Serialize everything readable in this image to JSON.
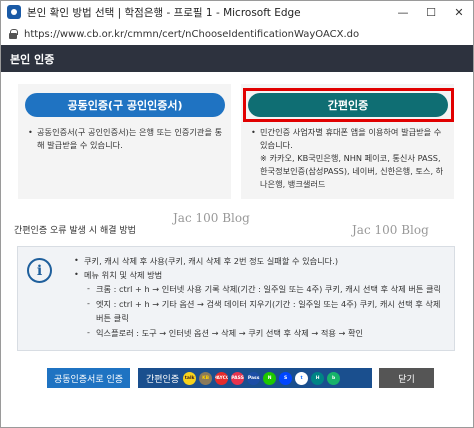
{
  "window": {
    "title": "본인 확인 방법 선택 | 학점은행 - 프로필 1 - Microsoft Edge",
    "controls": [
      "—",
      "☐",
      "✕"
    ]
  },
  "address": {
    "url": "https://www.cb.or.kr/cmmn/cert/nChooseIdentificationWayOACX.do"
  },
  "dialog": {
    "title": "본인 인증",
    "cards": {
      "public": {
        "label": "공동인증(구 공인인증서)",
        "text": "공동인증서(구 공인인증서)는 은행 또는 인증기관을 통해 발급받을 수 있습니다."
      },
      "simple": {
        "label": "간편인증",
        "text": "민간인증 사업자별 휴대폰 앱을 이용하여 발급받을 수 있습니다.",
        "note": "※ 카카오, KB국민은행, NHN 페이코, 통신사 PASS, 한국정보인증(삼성PASS), 네이버, 신한은행, 토스, 하나은행, 뱅크샐러드"
      }
    },
    "watermark": "Jac 100 Blog",
    "help": {
      "title": "간편인증 오류 발생 시 해결 방법",
      "lines": [
        "쿠키, 캐시 삭제 후 사용(쿠키, 캐시 삭제 후 2번 정도 실패할 수 있습니다.)",
        "메뉴 위치 및 삭제 방법",
        "크롬 : ctrl + h → 인터넷 사용 기록 삭제(기간 : 일주일 또는 4주) 쿠키, 캐시 선택 후 삭제 버튼 클릭",
        "엣지 : ctrl + h → 기타 옵션 → 검색 데이터 지우기(기간 : 일주일 또는 4주) 쿠키, 캐시 선택 후 삭제",
        "버튼 클릭",
        "익스플로러 : 도구 → 인터넷 옵션 → 삭제 → 쿠키 선택 후 삭제 → 적용 → 확인"
      ]
    },
    "footer": {
      "public_button": "공동인증서로 인증",
      "simple_button": "간편인증",
      "close_button": "닫기",
      "providers": [
        {
          "name": "kakao-icon",
          "abbr": "talk",
          "color": "#f7d31c",
          "fg": "#3a1d1d"
        },
        {
          "name": "kb-icon",
          "abbr": "KB",
          "color": "#8a7a5a",
          "fg": "#ffd300"
        },
        {
          "name": "payco-icon",
          "abbr": "PAYCO",
          "color": "#e52b2b",
          "fg": "#ffffff"
        },
        {
          "name": "pass-icon",
          "abbr": "PASS",
          "color": "#e8344e",
          "fg": "#ffffff"
        },
        {
          "name": "samsung-pass-icon",
          "abbr": "Pass",
          "color": "#1c4ea6",
          "fg": "#ffffff"
        },
        {
          "name": "naver-icon",
          "abbr": "N",
          "color": "#1ec800",
          "fg": "#ffffff"
        },
        {
          "name": "shinhan-icon",
          "abbr": "S",
          "color": "#0046ff",
          "fg": "#ffffff"
        },
        {
          "name": "toss-icon",
          "abbr": "t",
          "color": "#ffffff",
          "fg": "#0064ff"
        },
        {
          "name": "hana-icon",
          "abbr": "H",
          "color": "#008485",
          "fg": "#ffffff"
        },
        {
          "name": "banksalad-icon",
          "abbr": "b",
          "color": "#17b26a",
          "fg": "#ffffff"
        }
      ]
    }
  }
}
